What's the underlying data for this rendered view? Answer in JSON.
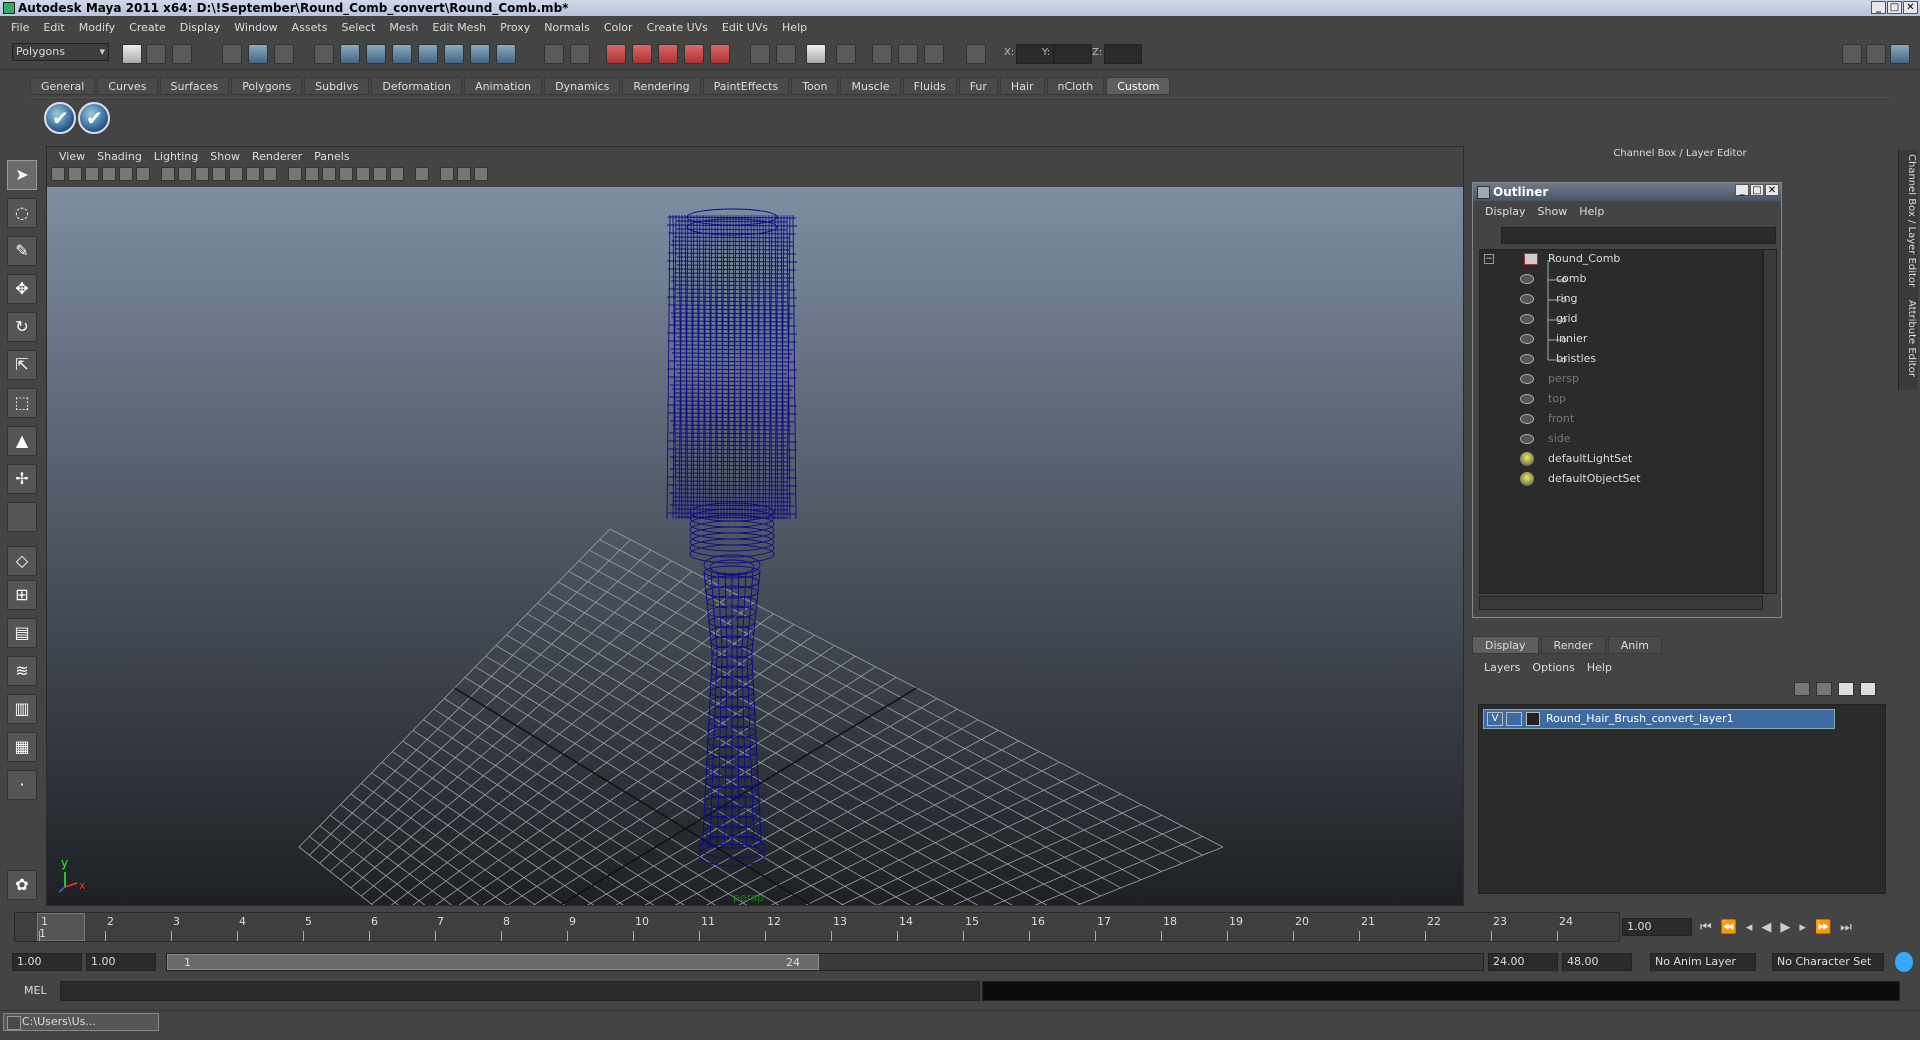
{
  "window": {
    "title": "Autodesk Maya 2011 x64: D:\\!September\\Round_Comb_convert\\Round_Comb.mb*"
  },
  "menubar": [
    "File",
    "Edit",
    "Modify",
    "Create",
    "Display",
    "Window",
    "Assets",
    "Select",
    "Mesh",
    "Edit Mesh",
    "Proxy",
    "Normals",
    "Color",
    "Create UVs",
    "Edit UVs",
    "Help"
  ],
  "status": {
    "mode": "Polygons",
    "x_label": "X:",
    "y_label": "Y:",
    "z_label": "Z:"
  },
  "shelf": {
    "tabs": [
      "General",
      "Curves",
      "Surfaces",
      "Polygons",
      "Subdivs",
      "Deformation",
      "Animation",
      "Dynamics",
      "Rendering",
      "PaintEffects",
      "Toon",
      "Muscle",
      "Fluids",
      "Fur",
      "Hair",
      "nCloth",
      "Custom"
    ],
    "active": "Custom"
  },
  "viewport": {
    "menu": [
      "View",
      "Shading",
      "Lighting",
      "Show",
      "Renderer",
      "Panels"
    ],
    "camera_label": "persp",
    "axis_y": "y",
    "axis_x": "x",
    "wire_color": "#0b0b8a"
  },
  "channelbox": {
    "header": "Channel Box / Layer Editor",
    "side_tab_1": "Channel Box / Layer Editor",
    "side_tab_2": "Attribute Editor"
  },
  "outliner": {
    "title": "Outliner",
    "menu": [
      "Display",
      "Show",
      "Help"
    ],
    "items": [
      {
        "label": "Round_Comb",
        "dim": false
      },
      {
        "label": "comb",
        "dim": false
      },
      {
        "label": "ring",
        "dim": false
      },
      {
        "label": "grid",
        "dim": false
      },
      {
        "label": "innier",
        "dim": false
      },
      {
        "label": "bristles",
        "dim": false
      },
      {
        "label": "persp",
        "dim": true
      },
      {
        "label": "top",
        "dim": true
      },
      {
        "label": "front",
        "dim": true
      },
      {
        "label": "side",
        "dim": true
      },
      {
        "label": "defaultLightSet",
        "dim": false
      },
      {
        "label": "defaultObjectSet",
        "dim": false
      }
    ]
  },
  "layers": {
    "tabs": [
      "Display",
      "Render",
      "Anim"
    ],
    "active": "Display",
    "menu": [
      "Layers",
      "Options",
      "Help"
    ],
    "row": {
      "visible": "V",
      "name": "Round_Hair_Brush_convert_layer1"
    }
  },
  "timeline": {
    "frames": [
      "1",
      "2",
      "3",
      "4",
      "5",
      "6",
      "7",
      "8",
      "9",
      "10",
      "11",
      "12",
      "13",
      "14",
      "15",
      "16",
      "17",
      "18",
      "19",
      "20",
      "21",
      "22",
      "23",
      "24"
    ],
    "current_frame": "1.00",
    "start_label": "1"
  },
  "range": {
    "start": "1.00",
    "playback_start": "1.00",
    "range_start_label": "1",
    "range_end_label": "24",
    "playback_end": "24.00",
    "end": "48.00",
    "anim_layer": "No Anim Layer",
    "character_set": "No Character Set"
  },
  "command": {
    "label": "MEL"
  },
  "taskbar": {
    "window_label": "C:\\Users\\Us..."
  }
}
